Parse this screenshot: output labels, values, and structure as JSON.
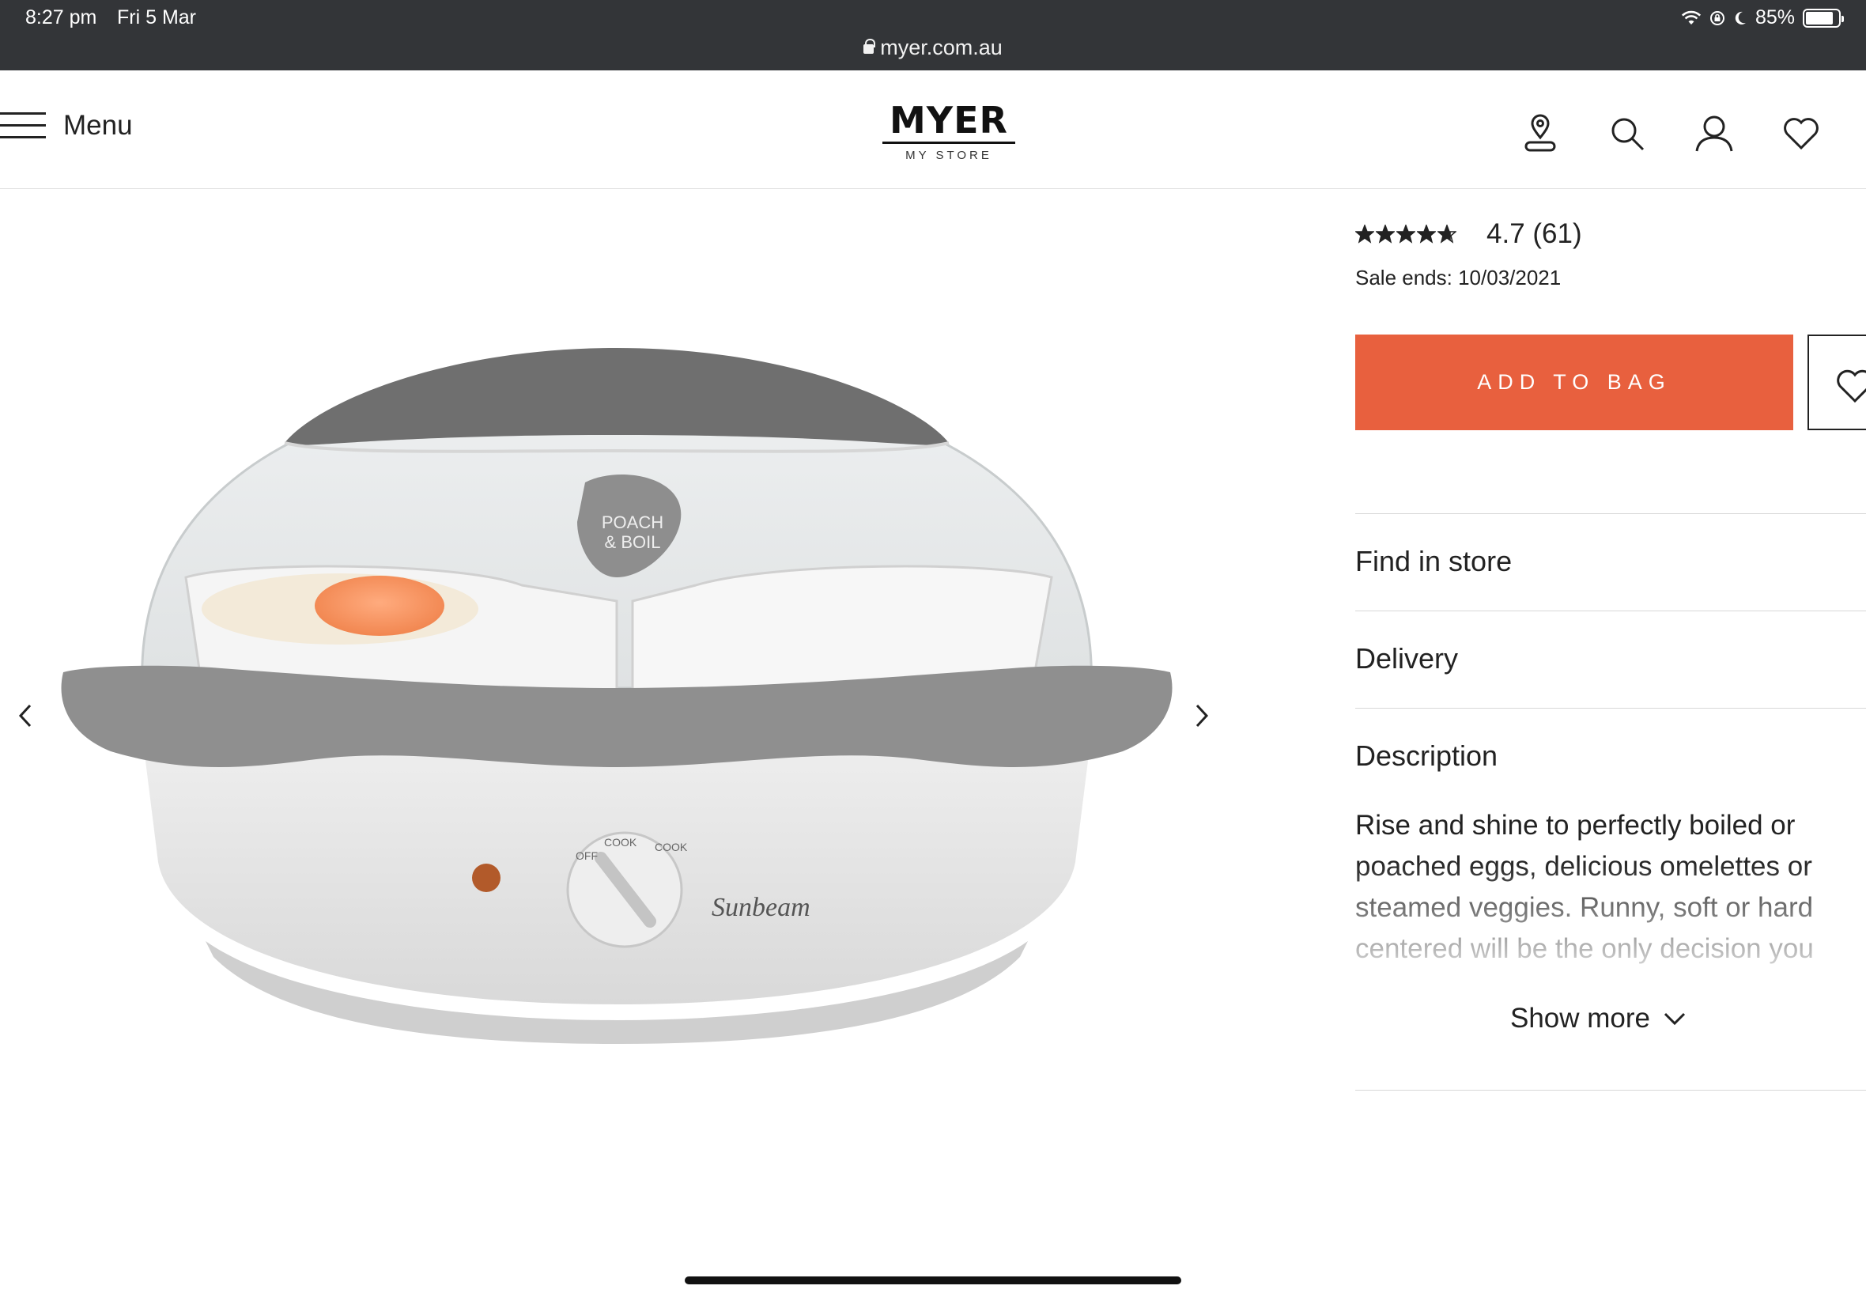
{
  "status_bar": {
    "time": "8:27 pm",
    "date": "Fri 5 Mar",
    "url": "myer.com.au",
    "battery": "85%",
    "battery_level": 0.85
  },
  "header": {
    "menu_label": "Menu",
    "logo_brand": "MYER",
    "logo_sub": "MY STORE",
    "icons": [
      "store-locator-icon",
      "search-icon",
      "account-icon",
      "wishlist-icon",
      "bag-icon"
    ]
  },
  "product": {
    "image_labels": {
      "badge_line1": "POACH",
      "badge_line2": "& BOIL",
      "dial_off": "OFF",
      "dial_cook1": "COOK",
      "dial_cook2": "COOK",
      "brand": "Sunbeam"
    },
    "rating_value": 4.7,
    "rating_text": "4.7 (61)",
    "sale_ends": "Sale ends: 10/03/2021",
    "add_to_bag": "ADD TO BAG",
    "accordion": {
      "find_in_store": "Find in store",
      "delivery": "Delivery",
      "description": "Description"
    },
    "description_text": "Rise and shine to perfectly boiled or poached eggs, delicious omelettes or steamed veggies. Runny, soft or hard centered will be the only decision you",
    "show_more": "Show more"
  },
  "colors": {
    "accent": "#e8603e",
    "status_bar_bg": "#333538"
  }
}
